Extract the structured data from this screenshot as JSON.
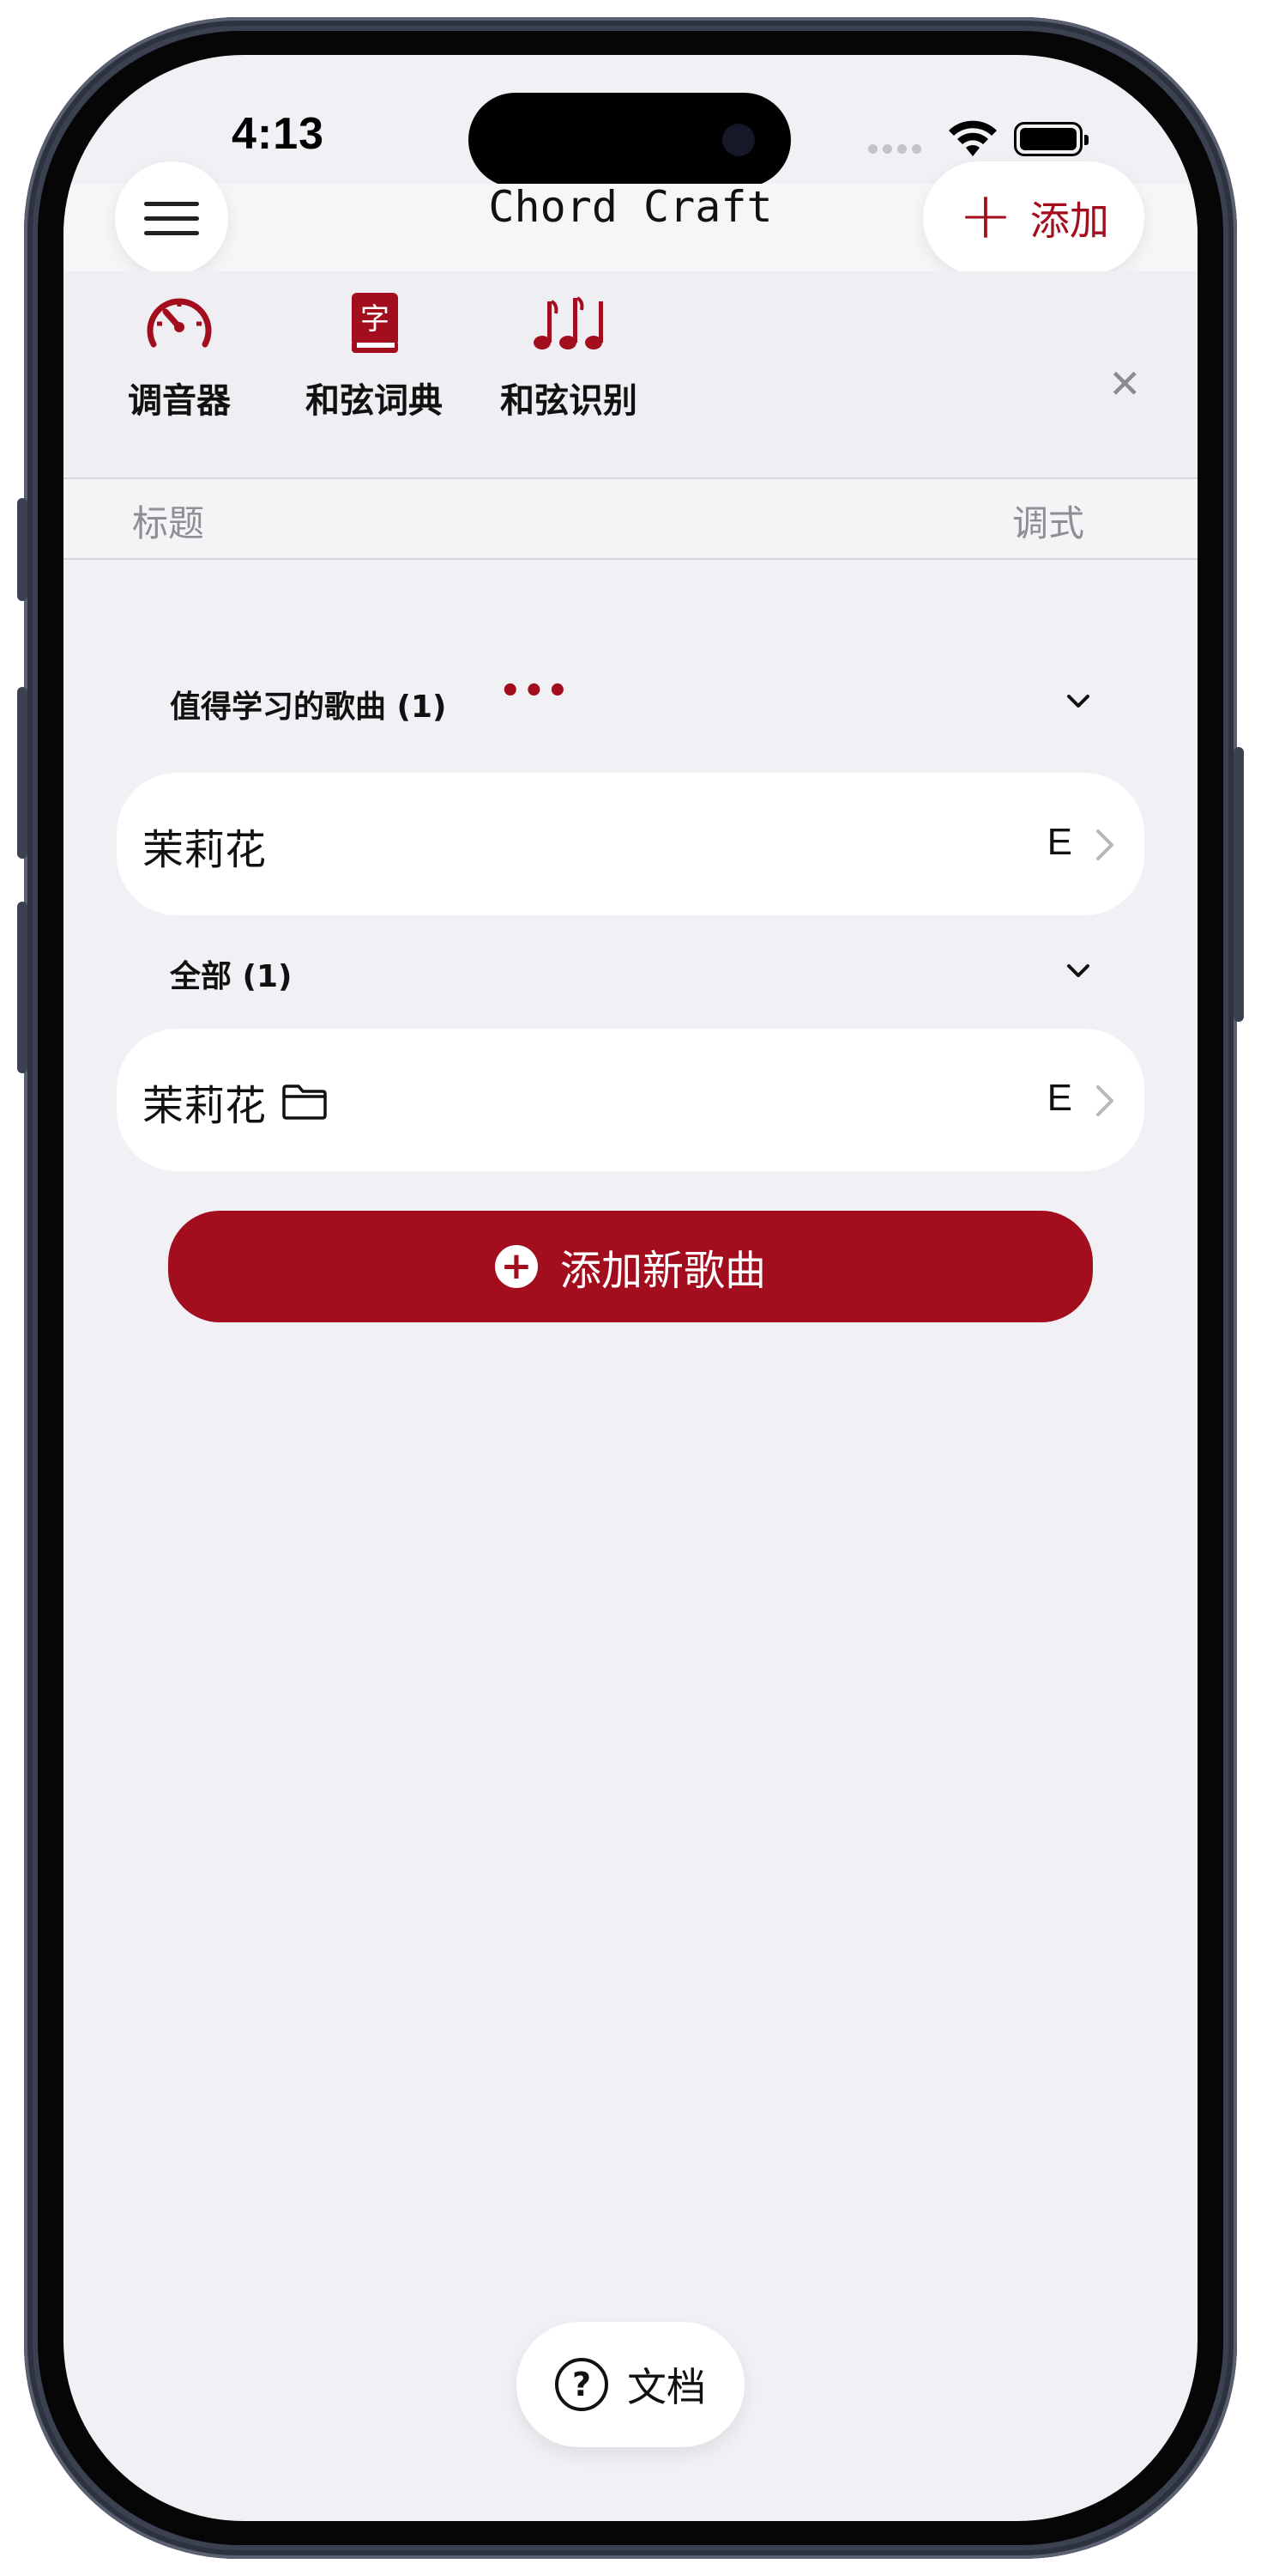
{
  "status": {
    "time": "4:13"
  },
  "nav": {
    "title": "Chord Craft",
    "add_label": "添加"
  },
  "tools": [
    {
      "label": "调音器",
      "icon": "speedometer-icon"
    },
    {
      "label": "和弦词典",
      "icon": "dictionary-book-icon",
      "glyph": "字"
    },
    {
      "label": "和弦识别",
      "icon": "music-notes-icon"
    }
  ],
  "columns": {
    "title": "标题",
    "key": "调式"
  },
  "sections": [
    {
      "title": "值得学习的歌曲 (1)",
      "songs": [
        {
          "name": "茉莉花",
          "key": "E",
          "has_folder": false
        }
      ]
    },
    {
      "title": "全部 (1)",
      "songs": [
        {
          "name": "茉莉花",
          "key": "E",
          "has_folder": true
        }
      ]
    }
  ],
  "actions": {
    "add_song": "添加新歌曲",
    "docs": "文档"
  },
  "colors": {
    "accent": "#a30e1e",
    "background": "#f0f0f5",
    "card": "#ffffff"
  }
}
